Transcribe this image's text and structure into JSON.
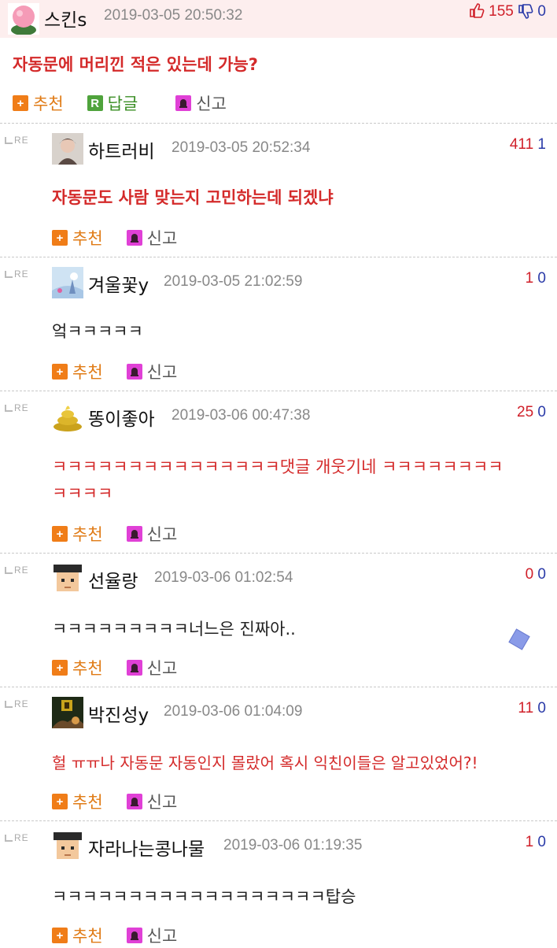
{
  "top": {
    "nick": "스킨s",
    "time": "2019-03-05 20:50:32",
    "up": "155",
    "down": "0",
    "content": "자동문에 머리낀 적은 있는데 가능?",
    "actions": {
      "recommend": "추천",
      "reply": "답글",
      "report": "신고"
    }
  },
  "re_label": "RE",
  "labels": {
    "recommend": "추천",
    "report": "신고",
    "plus": "+",
    "r": "R"
  },
  "replies": [
    {
      "nick": "하트러비",
      "time": "2019-03-05 20:52:34",
      "up": "411",
      "down": "1",
      "content": "자동문도 사람 맞는지 고민하는데 되겠냐",
      "content2": ""
    },
    {
      "nick": "겨울꽃y",
      "time": "2019-03-05 21:02:59",
      "up": "1",
      "down": "0",
      "content": "엌ㅋㅋㅋㅋㅋ",
      "content2": ""
    },
    {
      "nick": "똥이좋아",
      "time": "2019-03-06 00:47:38",
      "up": "25",
      "down": "0",
      "content": "ㅋㅋㅋㅋㅋㅋㅋㅋㅋㅋㅋㅋㅋㅋㅋ댓글 개웃기네 ㅋㅋㅋㅋㅋㅋㅋㅋ",
      "content2": "ㅋㅋㅋㅋ"
    },
    {
      "nick": "선율랑",
      "time": "2019-03-06 01:02:54",
      "up": "0",
      "down": "0",
      "content": "ㅋㅋㅋㅋㅋㅋㅋㅋㅋ너느은 진짜아..",
      "content2": ""
    },
    {
      "nick": "박진성y",
      "time": "2019-03-06 01:04:09",
      "up": "11",
      "down": "0",
      "content": "헐 ㅠㅠ나 자동문 자동인지 몰랐어 혹시 익친이들은 알고있었어?!",
      "content2": ""
    },
    {
      "nick": "자라나는콩나물",
      "time": "2019-03-06 01:19:35",
      "up": "1",
      "down": "0",
      "content": "ㅋㅋㅋㅋㅋㅋㅋㅋㅋㅋㅋㅋㅋㅋㅋㅋㅋㅋ탑승",
      "content2": ""
    }
  ],
  "colors": {
    "up": "#d0202a",
    "down": "#2a3aa8",
    "highlight": "#d42a2a",
    "recommend": "#f07d18"
  }
}
